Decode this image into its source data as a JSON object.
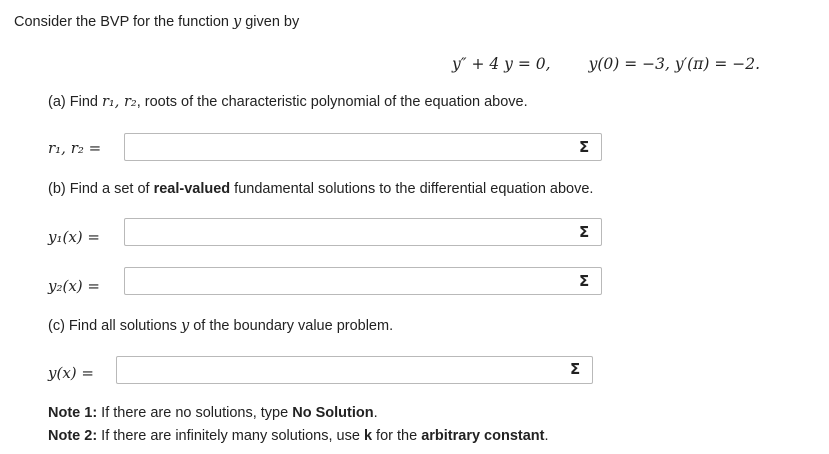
{
  "intro": {
    "text": "Consider the BVP for the function ",
    "var": "y",
    "after": " given by"
  },
  "equation": {
    "ode": "y″ + 4 y = 0,",
    "conditions": "y(0) = −3,   y′(π) = −2."
  },
  "part_a": {
    "pre": "(a) Find ",
    "vars": "r₁, r₂",
    "post": ", roots of the characteristic polynomial of the equation above.",
    "label": "r₁, r₂ ="
  },
  "part_b": {
    "pre": "(b) Find a set of ",
    "bold": "real-valued",
    "post": " fundamental solutions to the differential equation above.",
    "label_y1": "y₁(x) =",
    "label_y2": "y₂(x) ="
  },
  "part_c": {
    "pre": "(c) Find all solutions ",
    "var": "y",
    "post": " of the boundary value problem.",
    "label": "y(x) ="
  },
  "notes": {
    "note1_title": "Note 1:",
    "note1_pre": " If there are no solutions, type ",
    "note1_bold": "No Solution",
    "note1_post": ".",
    "note2_title": "Note 2:",
    "note2_pre": " If there are infinitely many solutions, use ",
    "note2_bold1": "k",
    "note2_mid": " for the ",
    "note2_bold2": "arbitrary constant",
    "note2_post": "."
  },
  "inputs": {
    "r1r2": "",
    "y1": "",
    "y2": "",
    "y": ""
  },
  "icons": {
    "equation_editor": "Σ"
  }
}
